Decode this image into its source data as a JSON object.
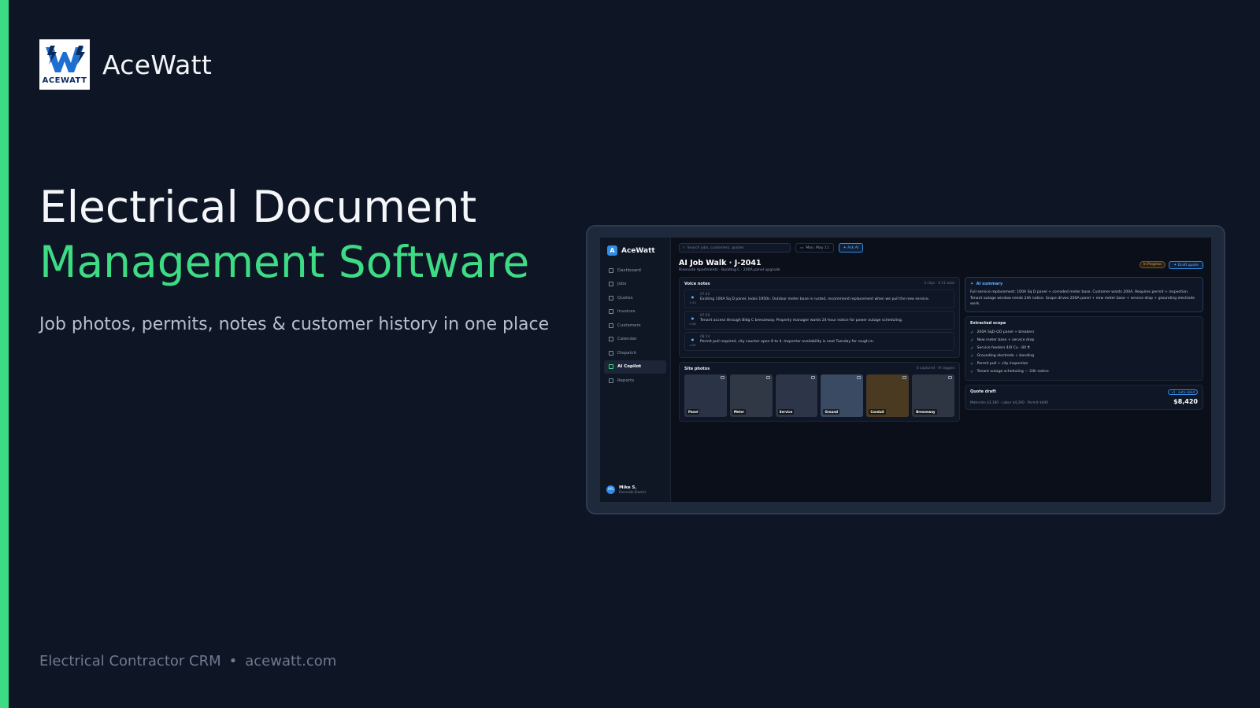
{
  "brand": {
    "logo_text": "ACEWATT",
    "name": "AceWatt"
  },
  "colors": {
    "accent": "#3ddc84",
    "background": "#0e1525",
    "link_blue": "#2f8ce8"
  },
  "headline": {
    "line1": "Electrical Document",
    "line2": "Management Software"
  },
  "subline": "Job photos, permits, notes & customer history in one place",
  "footer": {
    "left": "Electrical Contractor CRM",
    "separator": "•",
    "right": "acewatt.com"
  },
  "app": {
    "logo_letter": "A",
    "logo_name": "AceWatt",
    "sidebar": [
      {
        "label": "Dashboard",
        "icon": "chart-icon"
      },
      {
        "label": "Jobs",
        "icon": "briefcase-icon"
      },
      {
        "label": "Quotes",
        "icon": "document-icon"
      },
      {
        "label": "Invoices",
        "icon": "invoice-icon"
      },
      {
        "label": "Customers",
        "icon": "user-icon"
      },
      {
        "label": "Calendar",
        "icon": "calendar-icon"
      },
      {
        "label": "Dispatch",
        "icon": "truck-icon"
      },
      {
        "label": "AI Copilot",
        "icon": "sparkle-icon",
        "active": true
      },
      {
        "label": "Reports",
        "icon": "chart-icon"
      }
    ],
    "user": {
      "initials": "MS",
      "name": "Mike S.",
      "company": "Riverside Electric"
    },
    "search_placeholder": "Search jobs, customers, quotes",
    "date": "Mon, May 11",
    "ask_ai": "Ask AI",
    "job": {
      "title": "AI Job Walk · J-2041",
      "subtitle": "Riverside Apartments · Building C · 200A panel upgrade",
      "status": "In Progress",
      "draft_button": "Draft quote"
    },
    "voice_notes": {
      "title": "Voice notes",
      "meta": "3 clips · 4:11 total",
      "items": [
        {
          "time": "07:42",
          "duration": "1:34",
          "text": "Existing 100A Sq D panel, looks 1950s. Outdoor meter base is rusted, recommend replacement when we pull the new service."
        },
        {
          "time": "07:50",
          "duration": "0:48",
          "text": "Tenant access through Bldg C breezeway. Property manager wants 24-hour notice for power outage scheduling."
        },
        {
          "time": "08:14",
          "duration": "1:50",
          "text": "Permit pull required, city counter open 8 to 4. Inspector availability is next Tuesday for rough-in."
        }
      ]
    },
    "site_photos": {
      "title": "Site photos",
      "meta": "6 captured · AI tagged",
      "items": [
        {
          "label": "Panel",
          "color": "#2a3446"
        },
        {
          "label": "Meter",
          "color": "#303846"
        },
        {
          "label": "Service",
          "color": "#2c3648"
        },
        {
          "label": "Ground",
          "color": "#3a4a62"
        },
        {
          "label": "Conduit",
          "color": "#4a3a22"
        },
        {
          "label": "Breezeway",
          "color": "#2e3644"
        }
      ]
    },
    "ai_summary": {
      "title": "AI summary",
      "text": "Full service replacement: 100A Sq D panel + corroded meter base. Customer wants 200A. Requires permit + inspection. Tenant outage window needs 24h notice. Scope drives 200A panel + new meter base + service drop + grounding electrode work."
    },
    "extracted_scope": {
      "title": "Extracted scope",
      "items": [
        "200A SqD-QO panel + breakers",
        "New meter base + service drop",
        "Service feeders 4/0 Cu · 80 ft",
        "Grounding electrode + bonding",
        "Permit pull + city inspection",
        "Tenant outage scheduling — 24h notice"
      ]
    },
    "quote_draft": {
      "title": "Quote draft",
      "badge": "v1 · auto-sized",
      "breakdown": "Materials $3,180 · Labor $4,260 · Permit $640",
      "total": "$8,420"
    }
  }
}
